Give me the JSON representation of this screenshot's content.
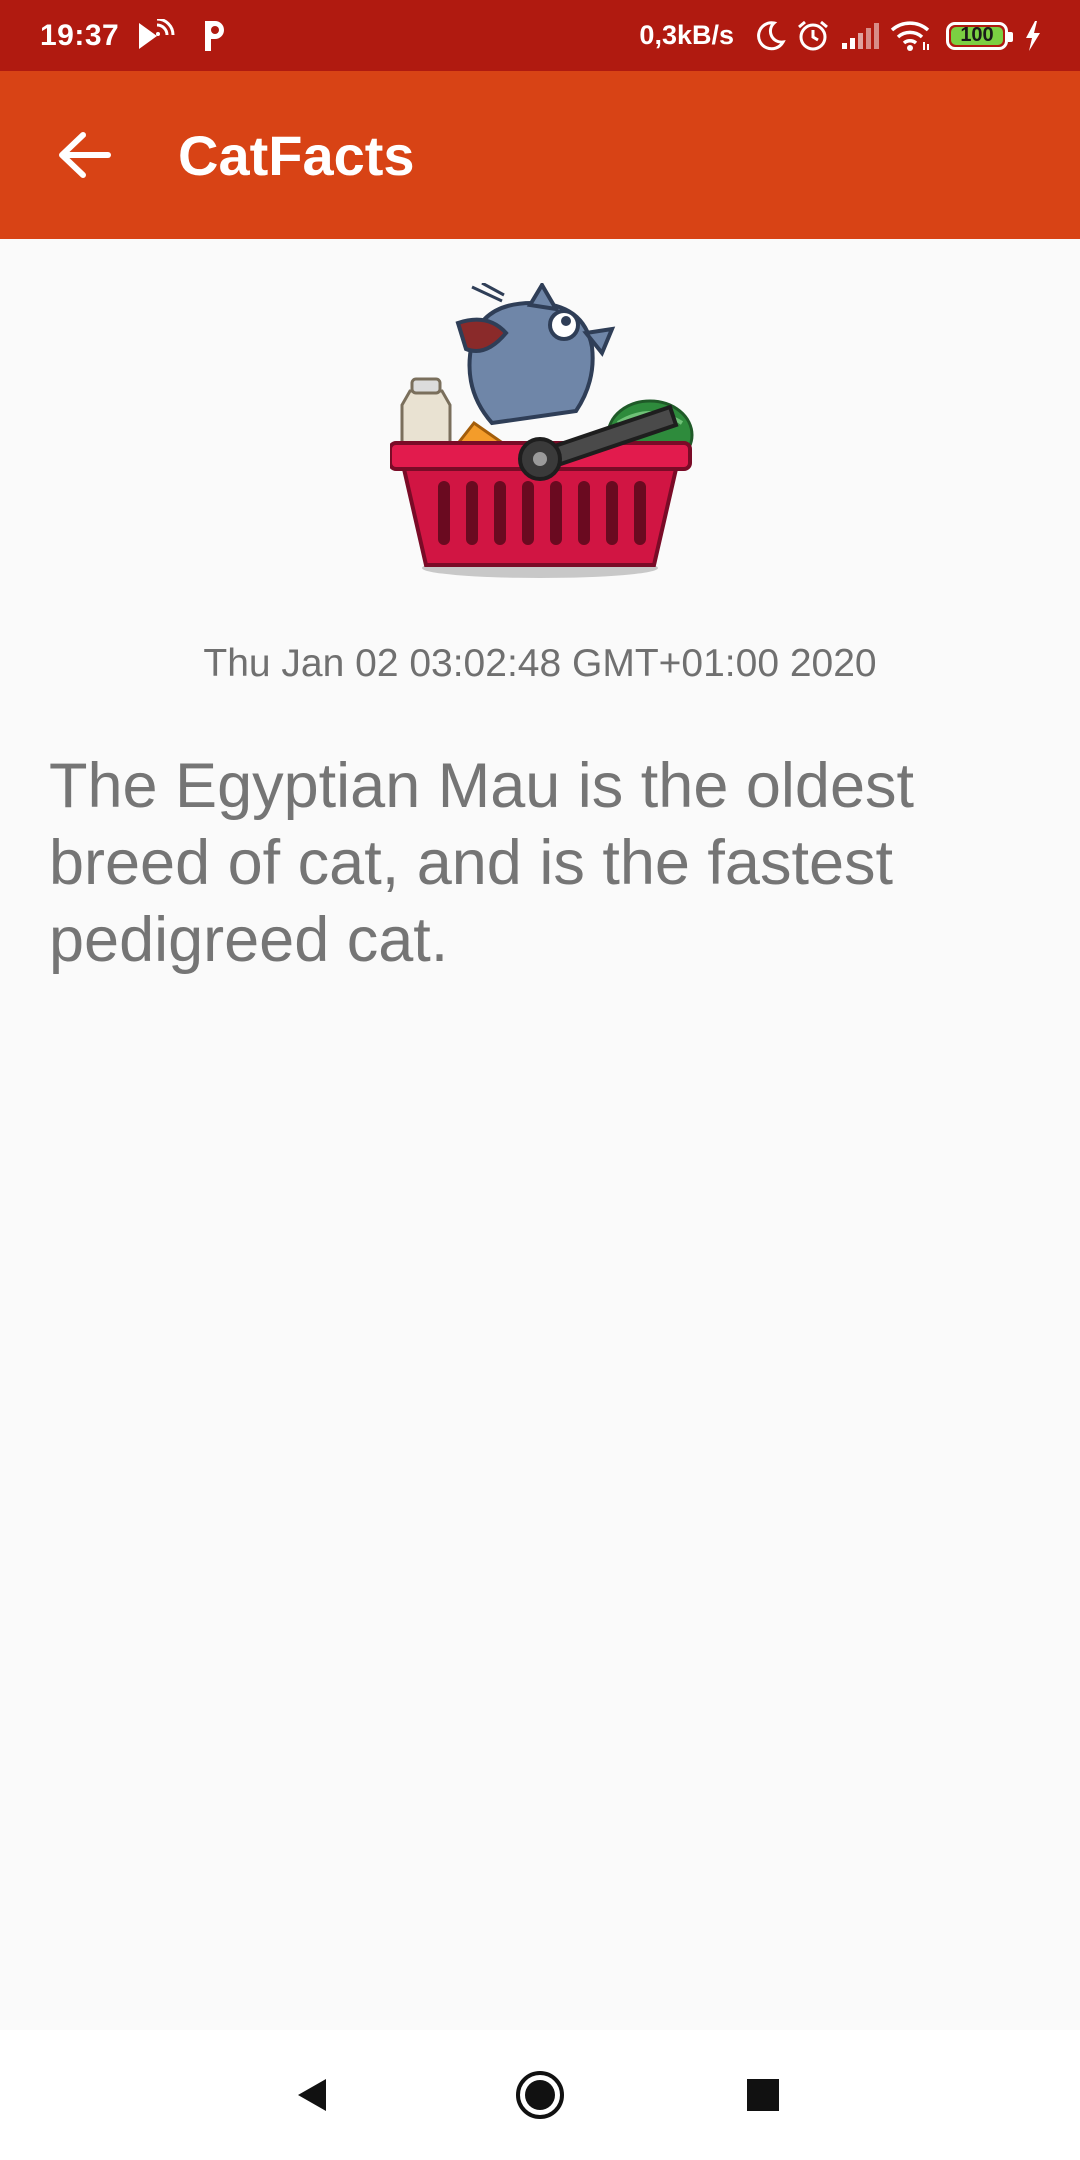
{
  "status_bar": {
    "time": "19:37",
    "net_speed": "0,3kB/s",
    "battery": "100",
    "icons": [
      "cast-icon",
      "p-app-icon",
      "moon-icon",
      "alarm-icon",
      "signal-icon",
      "wifi-icon",
      "battery-icon",
      "charging-icon"
    ]
  },
  "app_bar": {
    "title": "CatFacts",
    "back_icon": "arrow-back-icon",
    "color": "#d84315"
  },
  "fact": {
    "image": "cat-in-shopping-basket-sticker",
    "date": "Thu Jan 02 03:02:48 GMT+01:00 2020",
    "text": "The Egyptian Mau is the oldest breed of cat, and is the fastest pedigreed cat."
  },
  "nav_bar": {
    "icons": [
      "nav-back-icon",
      "nav-home-icon",
      "nav-recents-icon"
    ]
  },
  "colors": {
    "status_bar": "#b01a10",
    "app_bar": "#d84315",
    "background": "#fafafa",
    "text": "#757575"
  }
}
